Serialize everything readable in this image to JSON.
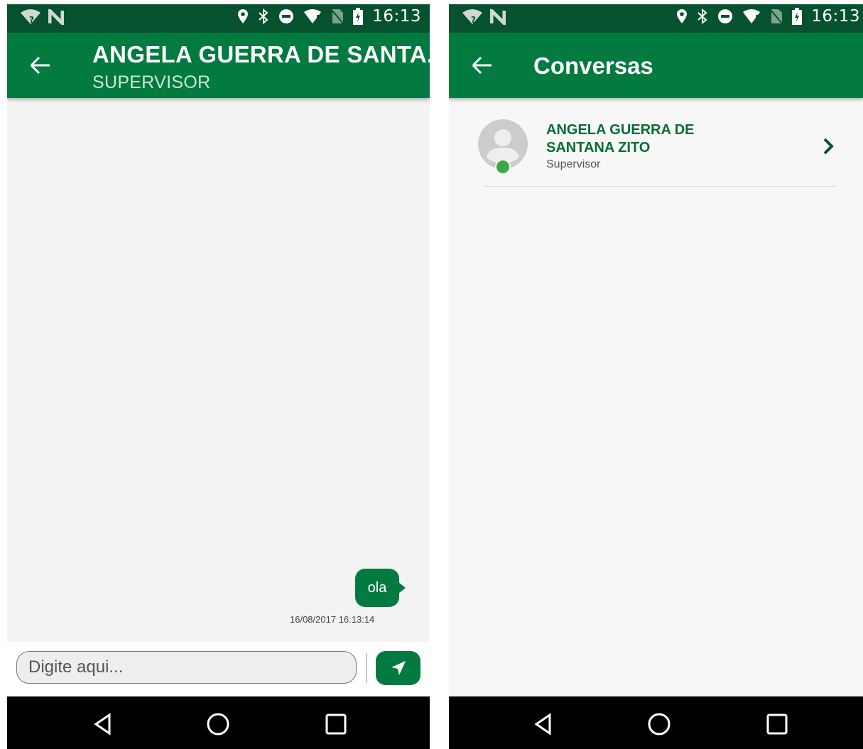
{
  "status_bar": {
    "time": "16:13"
  },
  "chat_screen": {
    "title": "ANGELA GUERRA DE SANTA...",
    "subtitle": "SUPERVISOR",
    "messages": [
      {
        "text": "ola",
        "timestamp": "16/08/2017 16:13:14"
      }
    ],
    "input": {
      "placeholder": "Digite aqui..."
    }
  },
  "conversations_screen": {
    "title": "Conversas",
    "items": [
      {
        "name": "ANGELA GUERRA DE SANTANA ZITO",
        "role": "Supervisor",
        "online": true
      }
    ]
  },
  "colors": {
    "status_bar": "#06522e",
    "app_bar": "#037a3f",
    "accent_text": "#0b6b36",
    "online": "#3aa845"
  }
}
